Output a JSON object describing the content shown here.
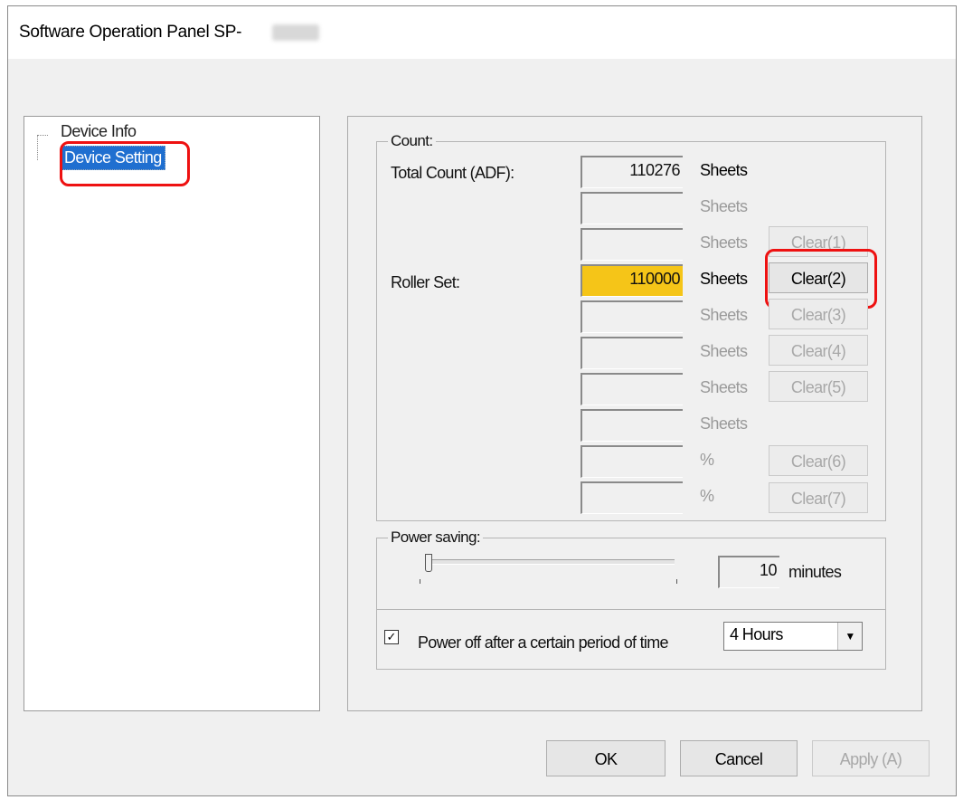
{
  "window": {
    "title": "Software Operation Panel SP-"
  },
  "tree": {
    "items": [
      {
        "label": "Device Info"
      },
      {
        "label": "Device Setting"
      }
    ]
  },
  "count": {
    "group_label": "Count:",
    "total_count_label": "Total Count (ADF):",
    "roller_set_label": "Roller Set:",
    "rows": [
      {
        "value": "110276",
        "unit": "Sheets",
        "clear": ""
      },
      {
        "value": "",
        "unit": "Sheets",
        "clear": ""
      },
      {
        "value": "",
        "unit": "Sheets",
        "clear": "Clear(1)"
      },
      {
        "value": "110000",
        "unit": "Sheets",
        "clear": "Clear(2)"
      },
      {
        "value": "",
        "unit": "Sheets",
        "clear": "Clear(3)"
      },
      {
        "value": "",
        "unit": "Sheets",
        "clear": "Clear(4)"
      },
      {
        "value": "",
        "unit": "Sheets",
        "clear": "Clear(5)"
      },
      {
        "value": "",
        "unit": "Sheets",
        "clear": ""
      },
      {
        "value": "",
        "unit": "%",
        "clear": "Clear(6)"
      },
      {
        "value": "",
        "unit": "%",
        "clear": "Clear(7)"
      }
    ]
  },
  "power_saving": {
    "group_label": "Power saving:",
    "minutes_value": "10",
    "minutes_unit": "minutes",
    "power_off_label": "Power off after a certain period of time",
    "power_off_checked": "✓",
    "power_off_selected": "4 Hours"
  },
  "footer": {
    "ok": "OK",
    "cancel": "Cancel",
    "apply": "Apply (A)"
  },
  "colors": {
    "highlight": "#f5c518",
    "selection": "#1f6fd0",
    "annotation": "#e11111"
  }
}
